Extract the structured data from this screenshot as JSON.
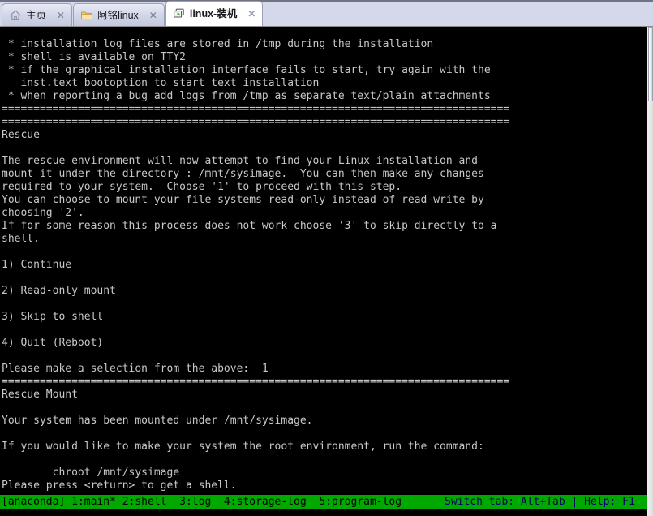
{
  "window": {
    "title": "linux-装机"
  },
  "tabs": [
    {
      "label": "主页",
      "icon": "home-icon",
      "close": "✕",
      "active": false
    },
    {
      "label": "阿铭linux",
      "icon": "folder-icon",
      "close": "✕",
      "active": false
    },
    {
      "label": "linux-装机",
      "icon": "remote-session-icon",
      "close": "✕",
      "active": true
    }
  ],
  "terminal": {
    "foreground": "#c8c8c8",
    "background": "#000000",
    "lines": [
      " * installation log files are stored in /tmp during the installation",
      " * shell is available on TTY2",
      " * if the graphical installation interface fails to start, try again with the",
      "   inst.text bootoption to start text installation",
      " * when reporting a bug add logs from /tmp as separate text/plain attachments",
      "================================================================================",
      "================================================================================",
      "Rescue",
      "",
      "The rescue environment will now attempt to find your Linux installation and",
      "mount it under the directory : /mnt/sysimage.  You can then make any changes",
      "required to your system.  Choose '1' to proceed with this step.",
      "You can choose to mount your file systems read-only instead of read-write by",
      "choosing '2'.",
      "If for some reason this process does not work choose '3' to skip directly to a",
      "shell.",
      "",
      "1) Continue",
      "",
      "2) Read-only mount",
      "",
      "3) Skip to shell",
      "",
      "4) Quit (Reboot)",
      "",
      "Please make a selection from the above:  1",
      "================================================================================",
      "Rescue Mount",
      "",
      "Your system has been mounted under /mnt/sysimage.",
      "",
      "If you would like to make your system the root environment, run the command:",
      "",
      "        chroot /mnt/sysimage",
      "Please press <return> to get a shell."
    ]
  },
  "statusbar": {
    "background": "#00a800",
    "left_color": "#000000",
    "right_color": "#000060",
    "left_text": "[anaconda] 1:main* 2:shell  3:log  4:storage-log  5:program-log",
    "right_text": "Switch tab: Alt+Tab | Help: F1",
    "tty_items": [
      "[anaconda]",
      "1:main*",
      "2:shell",
      "3:log",
      "4:storage-log",
      "5:program-log"
    ],
    "hints": [
      "Switch tab: Alt+Tab",
      "Help: F1"
    ]
  }
}
